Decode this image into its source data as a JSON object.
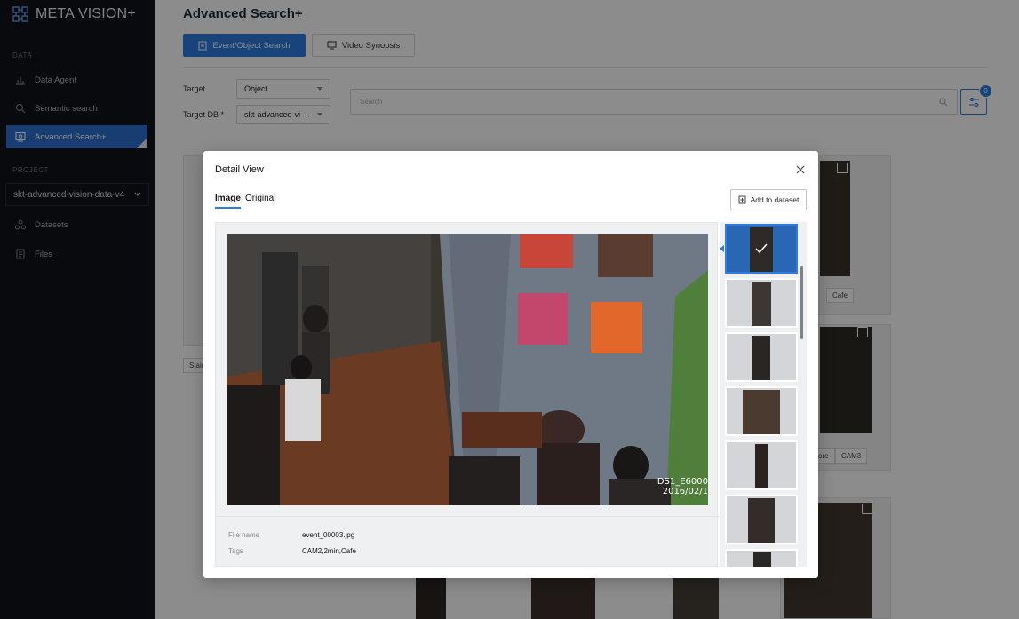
{
  "app": {
    "name": "META VISION+"
  },
  "sidebar": {
    "section_data": "DATA",
    "items": [
      {
        "label": "Data Agent",
        "icon": "bar-chart-icon"
      },
      {
        "label": "Semantic search",
        "icon": "search-icon"
      },
      {
        "label": "Advanced Search+",
        "icon": "image-search-icon",
        "active": true
      }
    ],
    "section_project": "PROJECT",
    "project": "skt-advanced-vision-data-v4",
    "project_items": [
      {
        "label": "Datasets",
        "icon": "dataset-icon"
      },
      {
        "label": "Files",
        "icon": "file-icon"
      }
    ]
  },
  "header": {
    "title": "Advanced Search+",
    "tabs": [
      {
        "label": "Event/Object Search",
        "active": true
      },
      {
        "label": "Video Synopsis",
        "active": false
      }
    ]
  },
  "filters": {
    "target_label": "Target",
    "target_value": "Object",
    "target_db_label": "Target DB *",
    "target_db_value": "skt-advanced-vi···",
    "search_placeholder": "Search",
    "filter_badge": "0"
  },
  "background_tags": [
    "Cafe",
    "Stair",
    "ore",
    "CAM3"
  ],
  "modal": {
    "title": "Detail View",
    "tabs": [
      "Image",
      "Original"
    ],
    "add_button": "Add to dataset",
    "overlay_text": [
      "DS1_E6000",
      "2016/02/1"
    ],
    "meta": [
      {
        "label": "File name",
        "value": "event_00003.jpg"
      },
      {
        "label": "Tags",
        "value": "CAM2,2min,Cafe"
      }
    ]
  },
  "colors": {
    "accent": "#2f7be0",
    "sidebar": "#101318"
  }
}
